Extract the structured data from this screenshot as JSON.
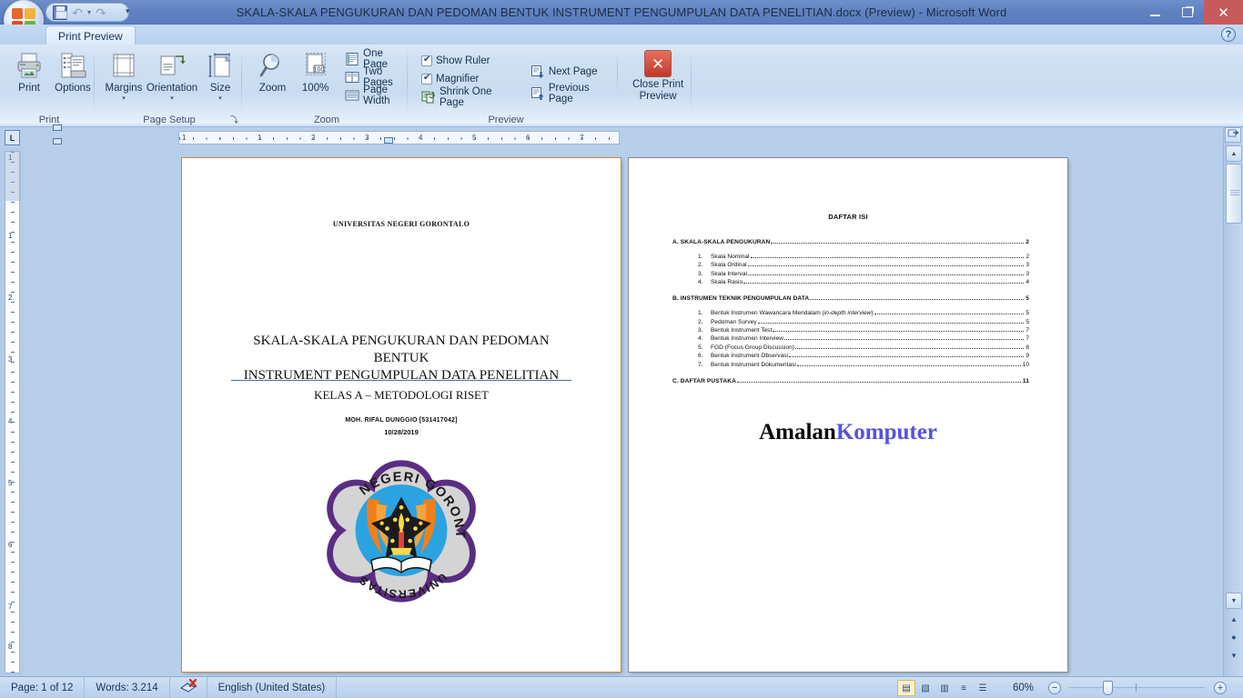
{
  "window": {
    "title": "SKALA-SKALA PENGUKURAN DAN PEDOMAN BENTUK INSTRUMENT PENGUMPULAN DATA PENELITIAN.docx (Preview) - Microsoft Word",
    "minimize_label": "Minimize",
    "maximize_label": "Restore",
    "close_label": "Close",
    "help_label": "?"
  },
  "quick_access": {
    "save": "save-icon",
    "undo": "↶",
    "undo_caret": "▾",
    "redo": "↷",
    "customize": "▾"
  },
  "tabs": [
    {
      "label": "Print Preview",
      "active": true
    }
  ],
  "ribbon": {
    "groups": [
      {
        "name": "Print",
        "label": "Print",
        "buttons": [
          {
            "label": "Print",
            "icon": "printer-icon"
          },
          {
            "label": "Options",
            "icon": "options-icon"
          }
        ]
      },
      {
        "name": "Page Setup",
        "label": "Page Setup",
        "buttons": [
          {
            "label": "Margins",
            "icon": "margins-icon",
            "caret": "▾"
          },
          {
            "label": "Orientation",
            "icon": "orientation-icon",
            "caret": "▾"
          },
          {
            "label": "Size",
            "icon": "size-icon",
            "caret": "▾"
          }
        ],
        "dialog_launcher": "⤵"
      },
      {
        "name": "Zoom",
        "label": "Zoom",
        "buttons": [
          {
            "label": "Zoom",
            "icon": "magnifier-icon"
          },
          {
            "label": "100%",
            "icon": "zoom-100-icon"
          }
        ],
        "small_buttons": [
          {
            "label": "One Page",
            "icon": "one-page-icon"
          },
          {
            "label": "Two Pages",
            "icon": "two-pages-icon"
          },
          {
            "label": "Page Width",
            "icon": "page-width-icon"
          }
        ]
      },
      {
        "name": "Preview",
        "label": "Preview",
        "checkboxes": [
          {
            "label": "Show Ruler",
            "checked": true
          },
          {
            "label": "Magnifier",
            "checked": true
          }
        ],
        "small_buttons": [
          {
            "label": "Shrink One Page",
            "icon": "shrink-one-page-icon"
          },
          {
            "label": "Next Page",
            "icon": "next-page-icon"
          },
          {
            "label": "Previous Page",
            "icon": "previous-page-icon"
          }
        ],
        "close_button": {
          "line1": "Close Print",
          "line2": "Preview",
          "icon": "close-x-icon"
        }
      }
    ]
  },
  "ruler": {
    "tab_selector": "L",
    "h_numbers": [
      "1",
      "1",
      "2",
      "3",
      "4",
      "5",
      "6",
      "7"
    ],
    "v_numbers": [
      "1",
      "1",
      "2",
      "3",
      "4",
      "5",
      "6",
      "7",
      "8"
    ]
  },
  "document": {
    "page1": {
      "university": "UNIVERSITAS NEGERI GORONTALO",
      "title_line1": "SKALA-SKALA PENGUKURAN DAN PEDOMAN BENTUK",
      "title_line2": "INSTRUMENT PENGUMPULAN DATA PENELITIAN",
      "subtitle": "KELAS A – METODOLOGI RISET",
      "author": "MOH. RIFAL DUNGGIO [531417042]",
      "date": "10/28/2019",
      "logo_alt": "universitas-negeri-gorontalo-logo"
    },
    "page2": {
      "heading": "DAFTAR ISI",
      "entries": [
        {
          "level": "major",
          "num": "",
          "text": "A. SKALA-SKALA PENGUKURAN",
          "page": "2"
        },
        {
          "level": "sub",
          "num": "1.",
          "text": "Skala Nominal",
          "page": "2"
        },
        {
          "level": "sub",
          "num": "2.",
          "text": "Skala Ordinal",
          "page": "3"
        },
        {
          "level": "sub",
          "num": "3.",
          "text": "Skala Interval",
          "page": "3"
        },
        {
          "level": "sub",
          "num": "4.",
          "text": "Skala Rasio",
          "page": "4"
        },
        {
          "level": "major",
          "num": "",
          "text": "B. INSTRUMEN TEKNIK PENGUMPULAN DATA",
          "page": "5"
        },
        {
          "level": "sub",
          "num": "1.",
          "text": "Bentuk Instrumen Wawancara Mendalam (",
          "italic": "in-depth interview",
          "text_after": ")",
          "page": "5"
        },
        {
          "level": "sub",
          "num": "2.",
          "text": "Pedoman Survey",
          "page": "5"
        },
        {
          "level": "sub",
          "num": "3.",
          "text": "Bentuk Instrument Test",
          "page": "7"
        },
        {
          "level": "sub",
          "num": "4.",
          "text": "Bentuk Instrumen Interview",
          "page": "7"
        },
        {
          "level": "sub",
          "num": "5.",
          "text": "FGD (Focus Group Discussion)",
          "page": "8"
        },
        {
          "level": "sub",
          "num": "6.",
          "text": "Bentuk Instrument Observasi",
          "page": "9"
        },
        {
          "level": "sub",
          "num": "7.",
          "text": "Bentuk Instrument Dokumentasi",
          "page": "10"
        },
        {
          "level": "major",
          "num": "",
          "text": "C. DAFTAR PUSTAKA",
          "page": "11"
        }
      ],
      "watermark_part1": "Amalan",
      "watermark_part2": "Komputer"
    }
  },
  "status_bar": {
    "page": "Page: 1 of 12",
    "words": "Words: 3.214",
    "proofing_icon": "spelling-check-icon",
    "language": "English (United States)",
    "zoom_level": "60%",
    "zoom_out": "−",
    "zoom_in": "+",
    "view_buttons": [
      {
        "name": "print-layout",
        "glyph": "▤",
        "active": true
      },
      {
        "name": "full-screen-reading",
        "glyph": "▧",
        "active": false
      },
      {
        "name": "web-layout",
        "glyph": "▥",
        "active": false
      },
      {
        "name": "outline",
        "glyph": "≡",
        "active": false
      },
      {
        "name": "draft",
        "glyph": "☰",
        "active": false
      }
    ]
  },
  "scrollbar": {
    "up_arrow": "▲",
    "down_arrow": "▼",
    "prev_object": "▴",
    "select_object": "●",
    "next_object": "▾",
    "split": "split-handle"
  },
  "colors": {
    "titlebar": "#5f81c0",
    "close_button": "#c75b5b",
    "ribbon": "#cbdcf0",
    "doc_background": "#b8cfec",
    "page_border_active": "#c08a3e",
    "watermark_blue": "#5751e0",
    "accent_text": "#16355c"
  }
}
